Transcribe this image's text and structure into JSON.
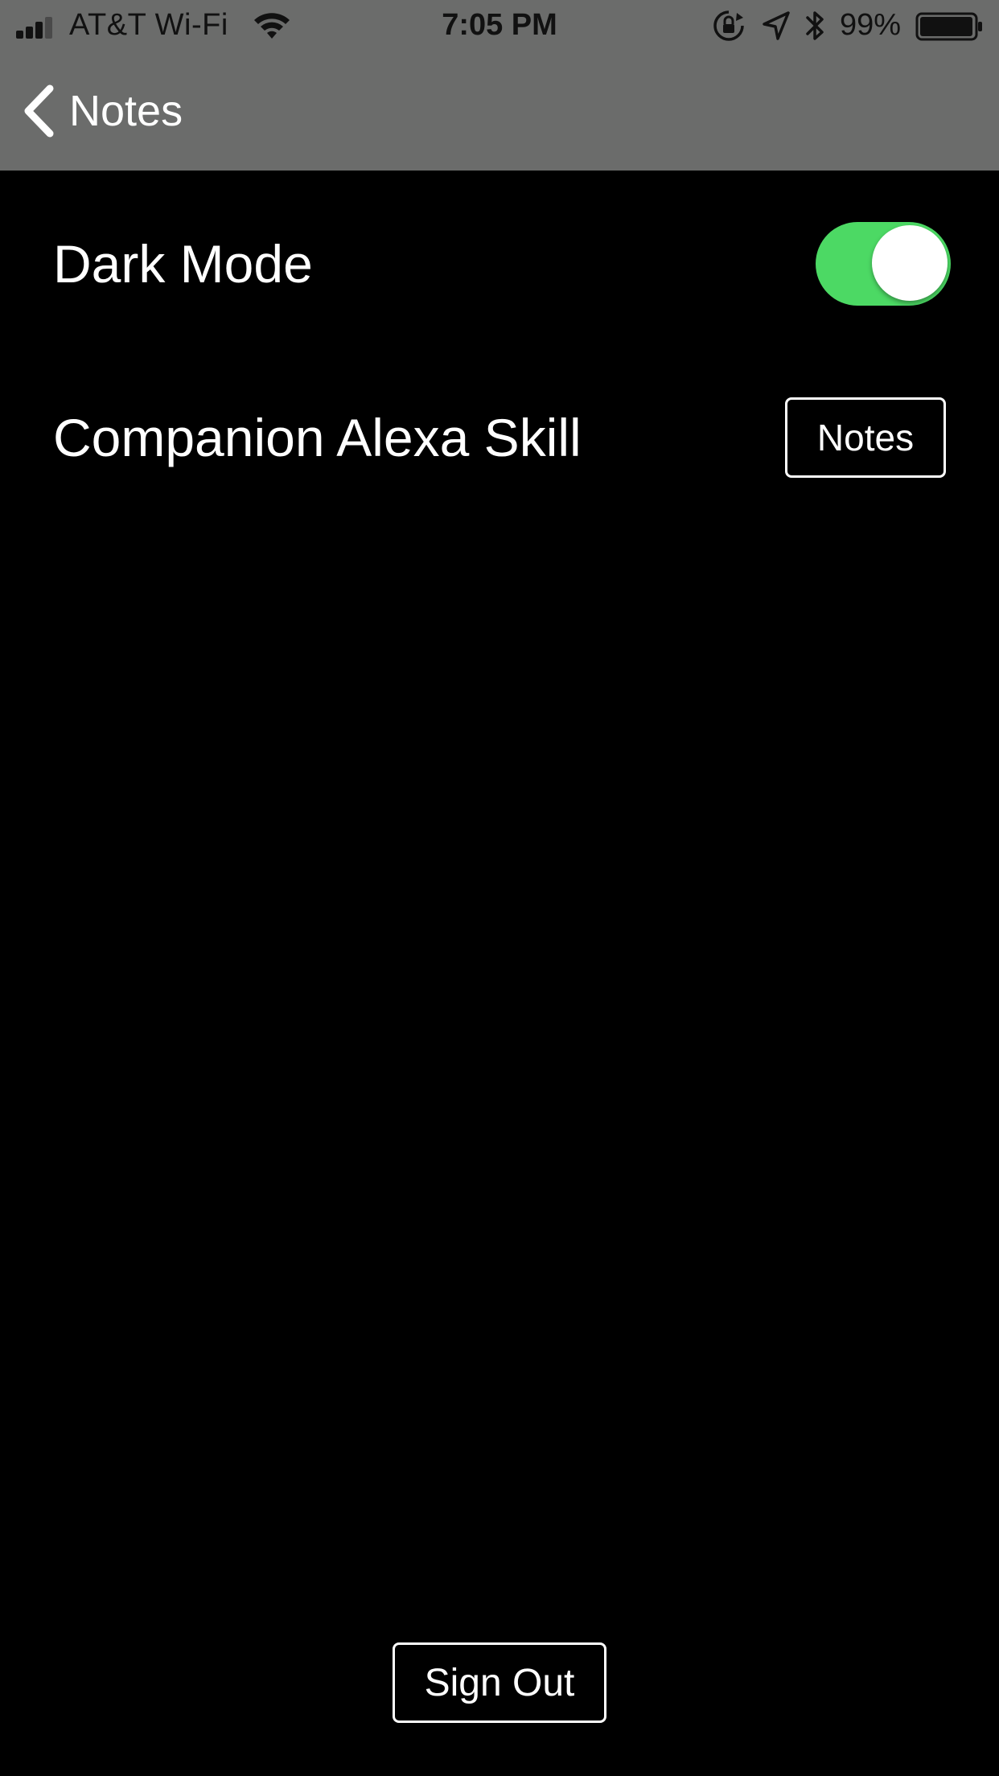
{
  "status_bar": {
    "carrier": "AT&T Wi-Fi",
    "time": "7:05 PM",
    "battery_percent": "99%",
    "icons": [
      "signal-icon",
      "wifi-icon",
      "rotation-lock-icon",
      "location-icon",
      "bluetooth-icon",
      "battery-icon"
    ]
  },
  "nav": {
    "back_label": "Notes",
    "back_icon": "chevron-left-icon"
  },
  "settings": {
    "dark_mode": {
      "label": "Dark Mode",
      "enabled": true
    },
    "alexa_skill": {
      "label": "Companion Alexa Skill",
      "button_label": "Notes"
    }
  },
  "footer": {
    "sign_out_label": "Sign Out"
  },
  "colors": {
    "toolbar_background": "#6b6c6b",
    "page_background": "#000000",
    "toggle_on": "#4cd964",
    "text": "#ffffff"
  }
}
